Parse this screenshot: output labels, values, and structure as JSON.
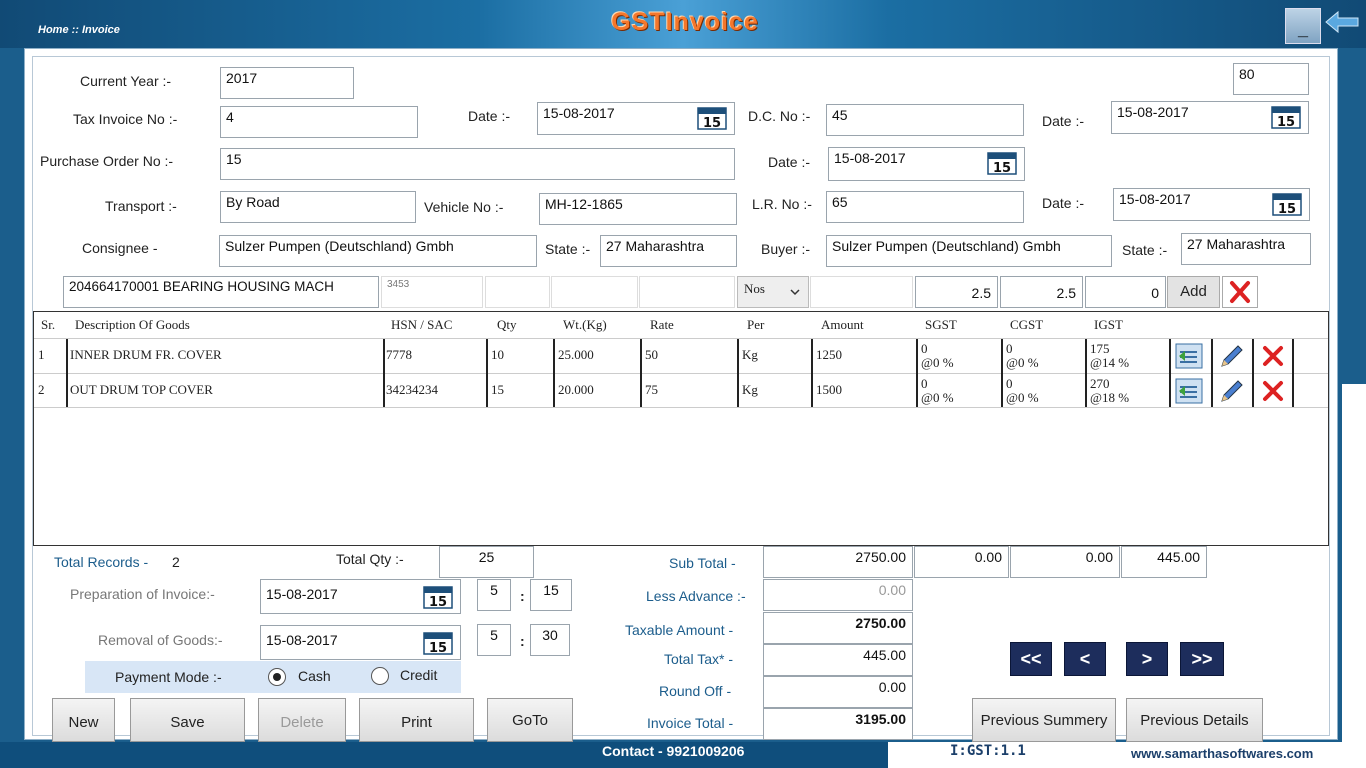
{
  "header": {
    "breadcrumb": "Home :: Invoice",
    "title": "GSTInvoice",
    "minimize_glyph": "_"
  },
  "form": {
    "current_year_label": "Current Year :-",
    "current_year": "2017",
    "counter_value": "80",
    "tax_invoice_label": "Tax Invoice No :-",
    "tax_invoice_no": "4",
    "date_label": "Date :-",
    "invoice_date": "15-08-2017",
    "dc_label": "D.C. No :-",
    "dc_no": "45",
    "dc_date": "15-08-2017",
    "po_label": "Purchase Order No :-",
    "po_no": "15",
    "po_date": "15-08-2017",
    "transport_label": "Transport :-",
    "transport": "By Road",
    "vehicle_label": "Vehicle No :-",
    "vehicle_no": "MH-12-1865",
    "lr_label": "L.R. No :-",
    "lr_no": "65",
    "lr_date": "15-08-2017",
    "consignee_label": "Consignee -",
    "consignee": "Sulzer Pumpen (Deutschland) Gmbh",
    "state_label": "State :-",
    "consignee_state": "27 Maharashtra",
    "buyer_label": "Buyer :-",
    "buyer": "Sulzer Pumpen (Deutschland) Gmbh",
    "buyer_state": "27 Maharashtra",
    "calendar_day": "15"
  },
  "entry": {
    "description": "204664170001 BEARING HOUSING MACH",
    "hsn": "3453",
    "unit": "Nos",
    "sgst_rate": "2.5",
    "cgst_rate": "2.5",
    "igst_rate": "0",
    "add_label": "Add"
  },
  "table": {
    "columns": [
      "Sr.",
      "Description Of Goods",
      "HSN / SAC",
      "Qty",
      "Wt.(Kg)",
      "Rate",
      "Per",
      "Amount",
      "SGST",
      "CGST",
      "IGST"
    ],
    "rows": [
      {
        "sr": "1",
        "desc": "INNER DRUM FR. COVER",
        "hsn": "7778",
        "qty": "10",
        "wt": "25.000",
        "rate": "50",
        "per": "Kg",
        "amount": "1250",
        "sgst": "0",
        "sgst_pct": "@0 %",
        "cgst": "0",
        "cgst_pct": "@0 %",
        "igst": "175",
        "igst_pct": "@14 %"
      },
      {
        "sr": "2",
        "desc": "OUT DRUM TOP COVER",
        "hsn": "34234234",
        "qty": "15",
        "wt": "20.000",
        "rate": "75",
        "per": "Kg",
        "amount": "1500",
        "sgst": "0",
        "sgst_pct": "@0 %",
        "cgst": "0",
        "cgst_pct": "@0 %",
        "igst": "270",
        "igst_pct": "@18 %"
      }
    ]
  },
  "summary": {
    "total_records_label": "Total Records -",
    "total_records": "2",
    "total_qty_label": "Total Qty :-",
    "total_qty": "25",
    "prep_label": "Preparation of Invoice:-",
    "prep_date": "15-08-2017",
    "prep_hour": "5",
    "prep_min": "15",
    "removal_label": "Removal of Goods:-",
    "removal_date": "15-08-2017",
    "removal_hour": "5",
    "removal_min": "30",
    "time_sep": ":",
    "payment_label": "Payment Mode :-",
    "cash_label": "Cash",
    "credit_label": "Credit",
    "subtotal_label": "Sub Total -",
    "subtotal": "2750.00",
    "sgst_total": "0.00",
    "cgst_total": "0.00",
    "igst_total": "445.00",
    "less_adv_label": "Less Advance :-",
    "less_advance": "0.00",
    "taxable_label": "Taxable Amount -",
    "taxable": "2750.00",
    "total_tax_label": "Total Tax* -",
    "total_tax": "445.00",
    "round_label": "Round Off -",
    "round_off": "0.00",
    "invoice_total_label": "Invoice Total -",
    "invoice_total": "3195.00"
  },
  "nav": {
    "first": "<<",
    "prev": "<",
    "next": ">",
    "last": ">>"
  },
  "buttons": {
    "new": "New",
    "save": "Save",
    "delete": "Delete",
    "print": "Print",
    "goto": "GoTo",
    "prev_summary": "Previous Summery",
    "prev_details": "Previous Details"
  },
  "footer": {
    "contact": "Contact - 9921009206",
    "version": "I:GST:1.1",
    "website": "www.samarthasoftwares.com"
  }
}
